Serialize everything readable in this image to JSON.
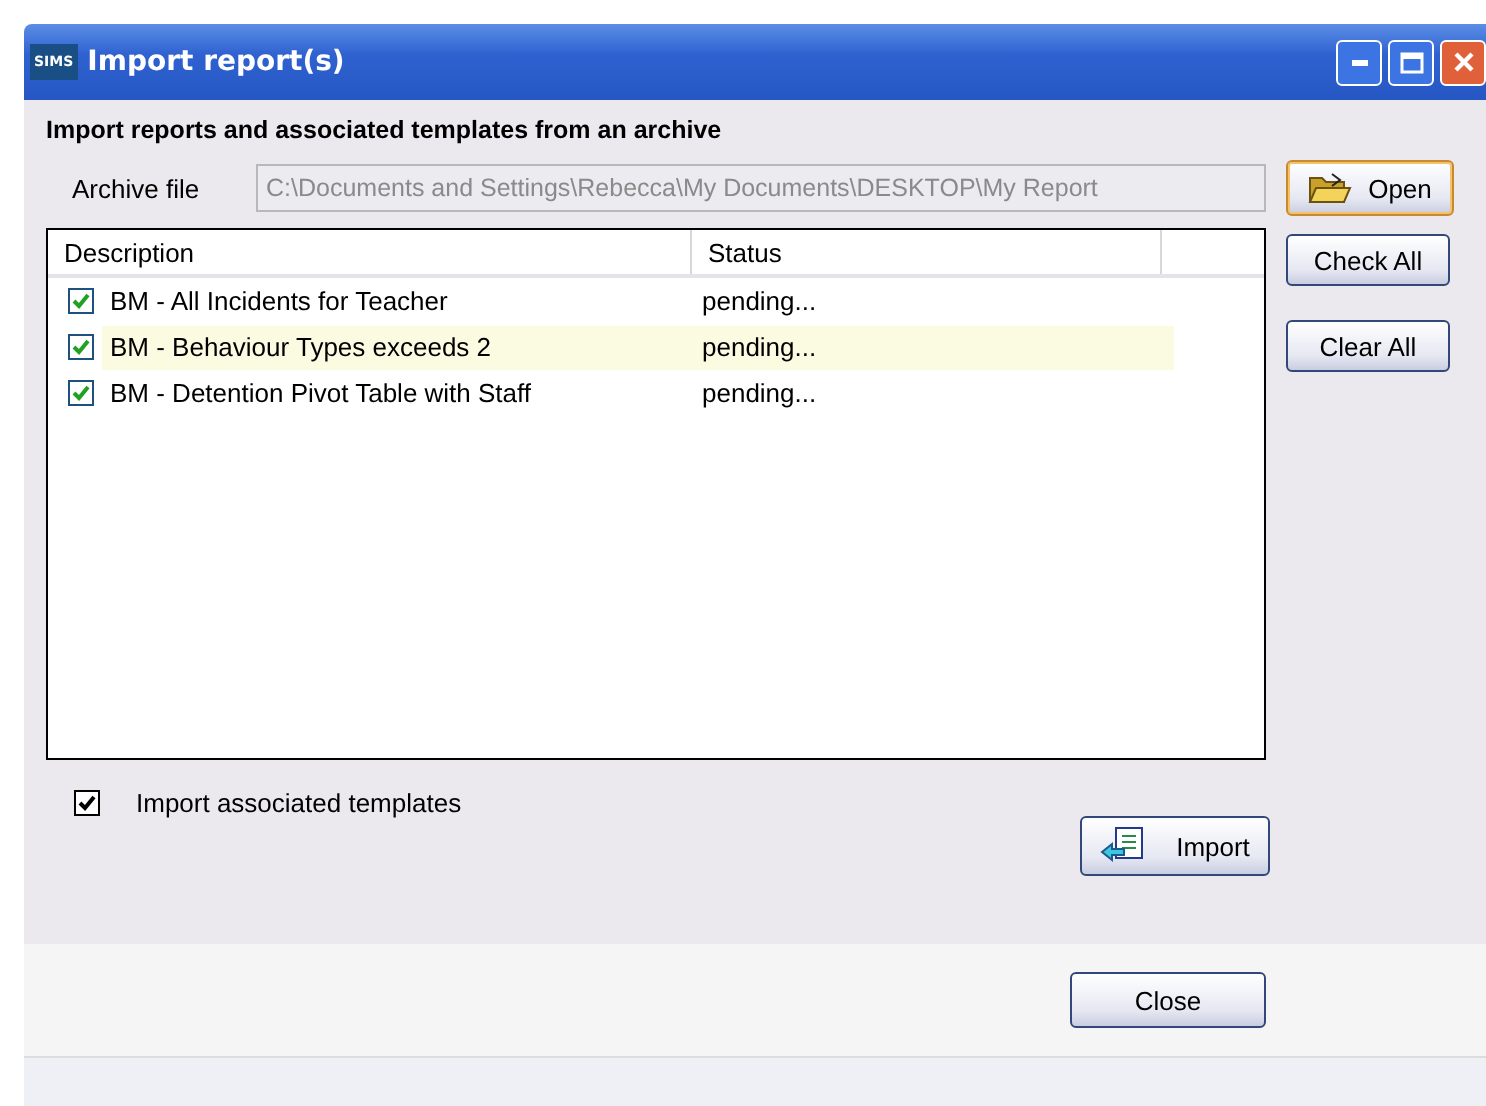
{
  "window": {
    "title": "Import report(s)",
    "app_badge": "SIMS"
  },
  "heading": "Import reports and associated templates from an archive",
  "archive": {
    "label": "Archive file",
    "value": "C:\\Documents and Settings\\Rebecca\\My Documents\\DESKTOP\\My Report",
    "disabled": true
  },
  "open_button": "Open",
  "table": {
    "columns": [
      "Description",
      "Status"
    ],
    "rows": [
      {
        "description": "BM - All Incidents for Teacher",
        "status": "pending...",
        "checked": true,
        "selected": false
      },
      {
        "description": "BM - Behaviour Types exceeds 2",
        "status": "pending...",
        "checked": true,
        "selected": true
      },
      {
        "description": "BM - Detention Pivot Table with Staff",
        "status": "pending...",
        "checked": true,
        "selected": false
      }
    ]
  },
  "side_buttons": [
    "Check All",
    "Clear All"
  ],
  "import_templates": {
    "label": "Import associated templates",
    "checked": true
  },
  "import_button": "Import",
  "close_button": "Close"
}
